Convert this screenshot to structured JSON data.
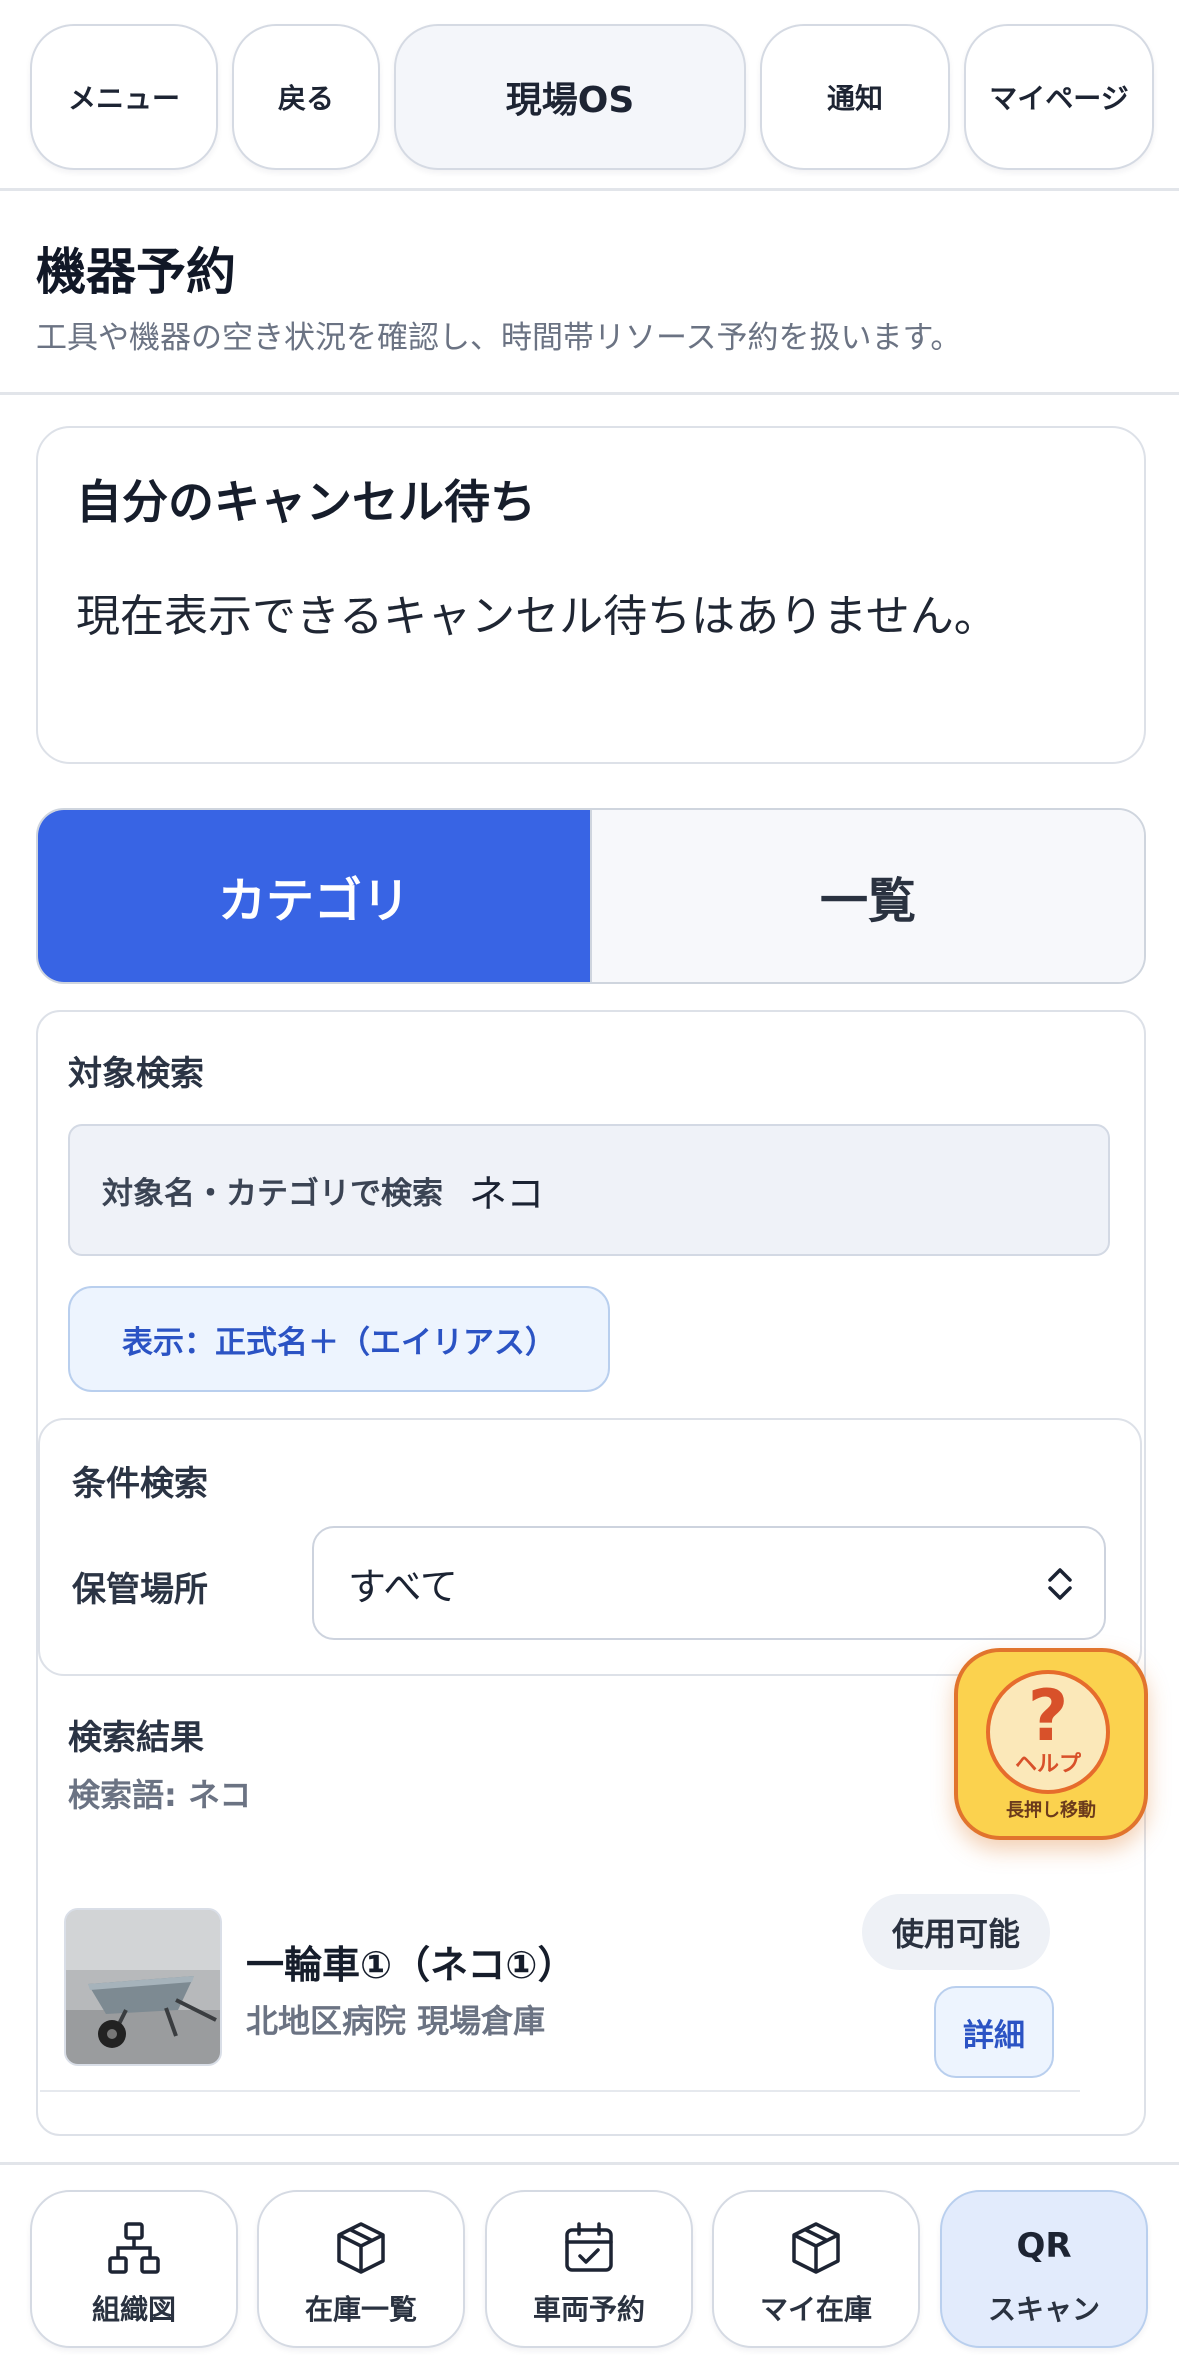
{
  "header": {
    "menu": "メニュー",
    "back": "戻る",
    "brand": "現場OS",
    "notifications": "通知",
    "mypage": "マイページ"
  },
  "page": {
    "title": "機器予約",
    "subtitle": "工具や機器の空き状況を確認し、時間帯リソース予約を扱います。"
  },
  "waitlist": {
    "title": "自分のキャンセル待ち",
    "empty_message": "現在表示できるキャンセル待ちはありません。"
  },
  "tabs": [
    {
      "label": "カテゴリ",
      "active": true
    },
    {
      "label": "一覧",
      "active": false
    }
  ],
  "search": {
    "section_label": "対象検索",
    "field_label": "対象名・カテゴリで検索",
    "value": "ネコ",
    "display_toggle": "表示：正式名＋（エイリアス）"
  },
  "conditions": {
    "section_label": "条件検索",
    "location_label": "保管場所",
    "location_value": "すべて"
  },
  "results": {
    "section_label": "検索結果",
    "query_line": "検索語: ネコ",
    "items": [
      {
        "name": "一輪車①（ネコ①）",
        "location": "北地区病院 現場倉庫",
        "status": "使用可能",
        "detail_label": "詳細"
      }
    ]
  },
  "help": {
    "symbol": "?",
    "label": "ヘルプ",
    "hint": "長押し移動"
  },
  "bottom_nav": {
    "org_chart": "組織図",
    "inventory": "在庫一覧",
    "vehicle": "車両予約",
    "my_inventory": "マイ在庫",
    "qr_top": "QR",
    "qr_label": "スキャン"
  },
  "colors": {
    "accent": "#3864e4",
    "help_bg": "#fbd24e",
    "help_border": "#e1742d"
  }
}
